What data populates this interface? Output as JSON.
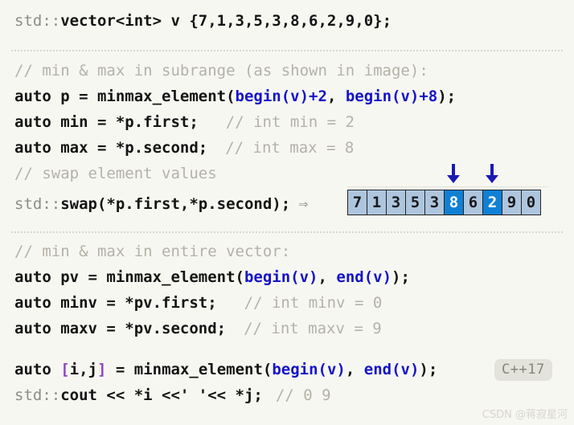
{
  "page": {
    "background_color": "#f7f7f2",
    "language": "cpp",
    "topic": "std::minmax_element"
  },
  "colors": {
    "background": "#f7f7f2",
    "namespace_grey": "#8d8d88",
    "code_black": "#141414",
    "comment_grey": "#b4b2a7",
    "library_blue": "#1414c8",
    "bracket_purple": "#8e44c8",
    "cell_fill": "#aec5de",
    "cell_highlight": "#1080d4",
    "cell_border": "#232323",
    "arrow_blue": "#1a1ab4",
    "badge_bg": "#e3e3dc",
    "badge_text": "#85857c",
    "divider": "#d8d6c9",
    "watermark": "#d7d5cc"
  },
  "code": {
    "line_declare": {
      "ns": "std::",
      "rest": "vector<int> v {7,1,3,5,3,8,6,2,9,0};"
    },
    "comment_subrange": "// min & max in subrange (as shown in image):",
    "line_p": {
      "a": "auto p = minmax_element(",
      "b": "begin(v)+2",
      "c": ", ",
      "d": "begin(v)+8",
      "e": ");"
    },
    "line_min": {
      "code": "auto min = *p.first;",
      "comment": "// int min = 2"
    },
    "line_max": {
      "code": "auto max = *p.second;",
      "comment": "// int max = 8"
    },
    "comment_swap": "// swap element values",
    "line_swap": {
      "ns": "std::",
      "rest": "swap(*p.first,*p.second);",
      "implies": "⇒"
    },
    "comment_entire": "// min & max in entire vector:",
    "line_pv": {
      "a": "auto pv = minmax_element(",
      "b": "begin(v)",
      "c": ", ",
      "d": "end(v)",
      "e": ");"
    },
    "line_minv": {
      "code": "auto minv = *pv.first;",
      "comment": "// int minv = 0"
    },
    "line_maxv": {
      "code": "auto maxv = *pv.second;",
      "comment": "// int maxv = 9"
    },
    "line_structured": {
      "a": "auto ",
      "lb": "[",
      "ij": "i,j",
      "rb": "]",
      "b": " = minmax_element(",
      "c": "begin(v)",
      "d": ", ",
      "e": "end(v)",
      "f": ");"
    },
    "line_cout": {
      "ns": "std::",
      "rest": "cout << *i <<' '<< *j;",
      "comment": "// 0 9"
    }
  },
  "badge": {
    "label": "C++17"
  },
  "array_figure": {
    "values": [
      "7",
      "1",
      "3",
      "5",
      "3",
      "8",
      "6",
      "2",
      "9",
      "0"
    ],
    "highlighted_indices": [
      5,
      7
    ],
    "arrow_glyph": "↓",
    "arrow_count": 2,
    "arrow_targets": [
      5,
      7
    ],
    "description": "vector contents after swap of min and max in subrange"
  },
  "watermark": {
    "text": "CSDN @蒋寂星河"
  }
}
